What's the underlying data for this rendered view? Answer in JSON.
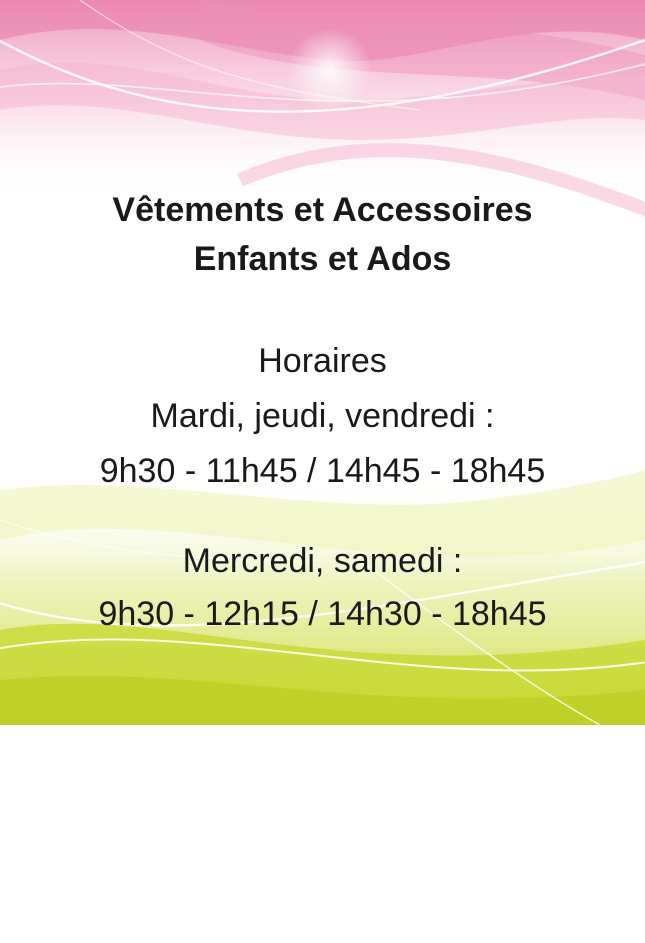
{
  "title": {
    "line1": "Vêtements et Accessoires",
    "line2": "Enfants et Ados"
  },
  "schedule": {
    "heading": "Horaires",
    "group1_days": "Mardi, jeudi, vendredi :",
    "group1_hours": "9h30 - 11h45 / 14h45 - 18h45",
    "group2_days": "Mercredi, samedi :",
    "group2_hours": "9h30 - 12h15 / 14h30 - 18h45"
  },
  "colors": {
    "pink": "#e8739f",
    "green": "#c8d82c",
    "text": "#1a1a1a"
  }
}
